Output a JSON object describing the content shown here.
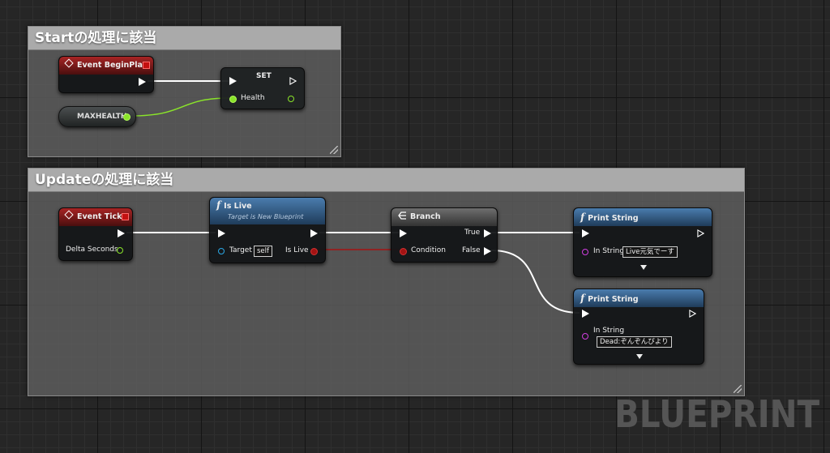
{
  "comments": {
    "start": {
      "title": "Startの処理に該当"
    },
    "update": {
      "title": "Updateの処理に該当"
    }
  },
  "nodes": {
    "begin_play": {
      "title": "Event BeginPlay"
    },
    "set": {
      "title": "SET",
      "pin_health": "Health"
    },
    "maxhealth": {
      "label": "MAXHEALTH"
    },
    "event_tick": {
      "title": "Event Tick",
      "pin_delta": "Delta Seconds"
    },
    "is_live": {
      "title": "Is Live",
      "subtitle": "Target is New Blueprint",
      "pin_target": "Target",
      "target_value": "self",
      "pin_out": "Is Live"
    },
    "branch": {
      "title": "Branch",
      "pin_condition": "Condition",
      "pin_true": "True",
      "pin_false": "False"
    },
    "print_true": {
      "title": "Print String",
      "pin_in": "In String",
      "value": "Live元気でーす"
    },
    "print_false": {
      "title": "Print String",
      "pin_in": "In String",
      "value": "Dead:ぞんぞんびより"
    }
  },
  "watermark": "BLUEPRINT",
  "colors": {
    "exec": "#ffffff",
    "bool": "#a31313",
    "float": "#8ae42a",
    "string": "#d03ee0",
    "object": "#2aa7e4"
  },
  "icons": [
    "event-diamond-icon",
    "delegate-square-icon",
    "function-f-icon",
    "branch-icon",
    "exec-pin-icon",
    "data-pin-icon",
    "expand-arrow-icon",
    "resize-grip-icon"
  ]
}
